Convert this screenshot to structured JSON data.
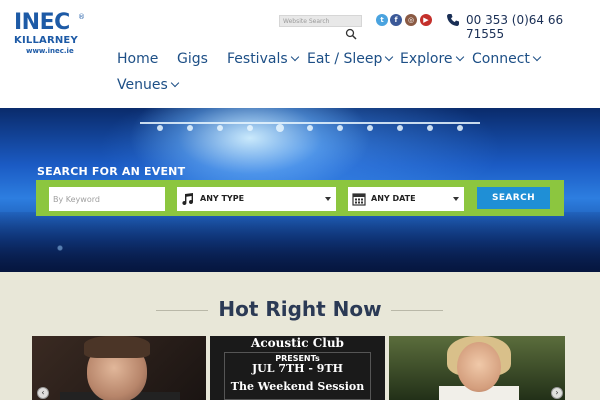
{
  "brand": {
    "name": "INEC",
    "reg_mark": "®",
    "subname": "KILLARNEY",
    "url": "www.inec.ie",
    "color": "#1d5aa6"
  },
  "topbar": {
    "search_placeholder": "Website Search",
    "social": [
      "twitter-icon",
      "facebook-icon",
      "instagram-icon",
      "youtube-icon"
    ],
    "phone": "00 353 (0)64 66 71555"
  },
  "nav": {
    "items": [
      {
        "label": "Home",
        "dropdown": false
      },
      {
        "label": "Gigs",
        "dropdown": false
      },
      {
        "label": "Festivals",
        "dropdown": true
      },
      {
        "label": "Eat / Sleep",
        "dropdown": true
      },
      {
        "label": "Explore",
        "dropdown": true
      },
      {
        "label": "Connect",
        "dropdown": true
      },
      {
        "label": "Venues",
        "dropdown": true
      }
    ]
  },
  "hero": {
    "title": "SEARCH FOR AN EVENT",
    "keyword_placeholder": "By Keyword",
    "type_select": "ANY TYPE",
    "date_select": "ANY DATE",
    "search_button": "SEARCH",
    "accent": "#8cc63f",
    "button_color": "#1f8fd6"
  },
  "hot": {
    "title": "Hot Right Now",
    "card2": {
      "heading": "Acoustic Club",
      "presents": "PRESENTs",
      "dates": "JUL 7TH - 9TH",
      "session": "The Weekend Session"
    },
    "prev": "‹",
    "next": "›"
  }
}
